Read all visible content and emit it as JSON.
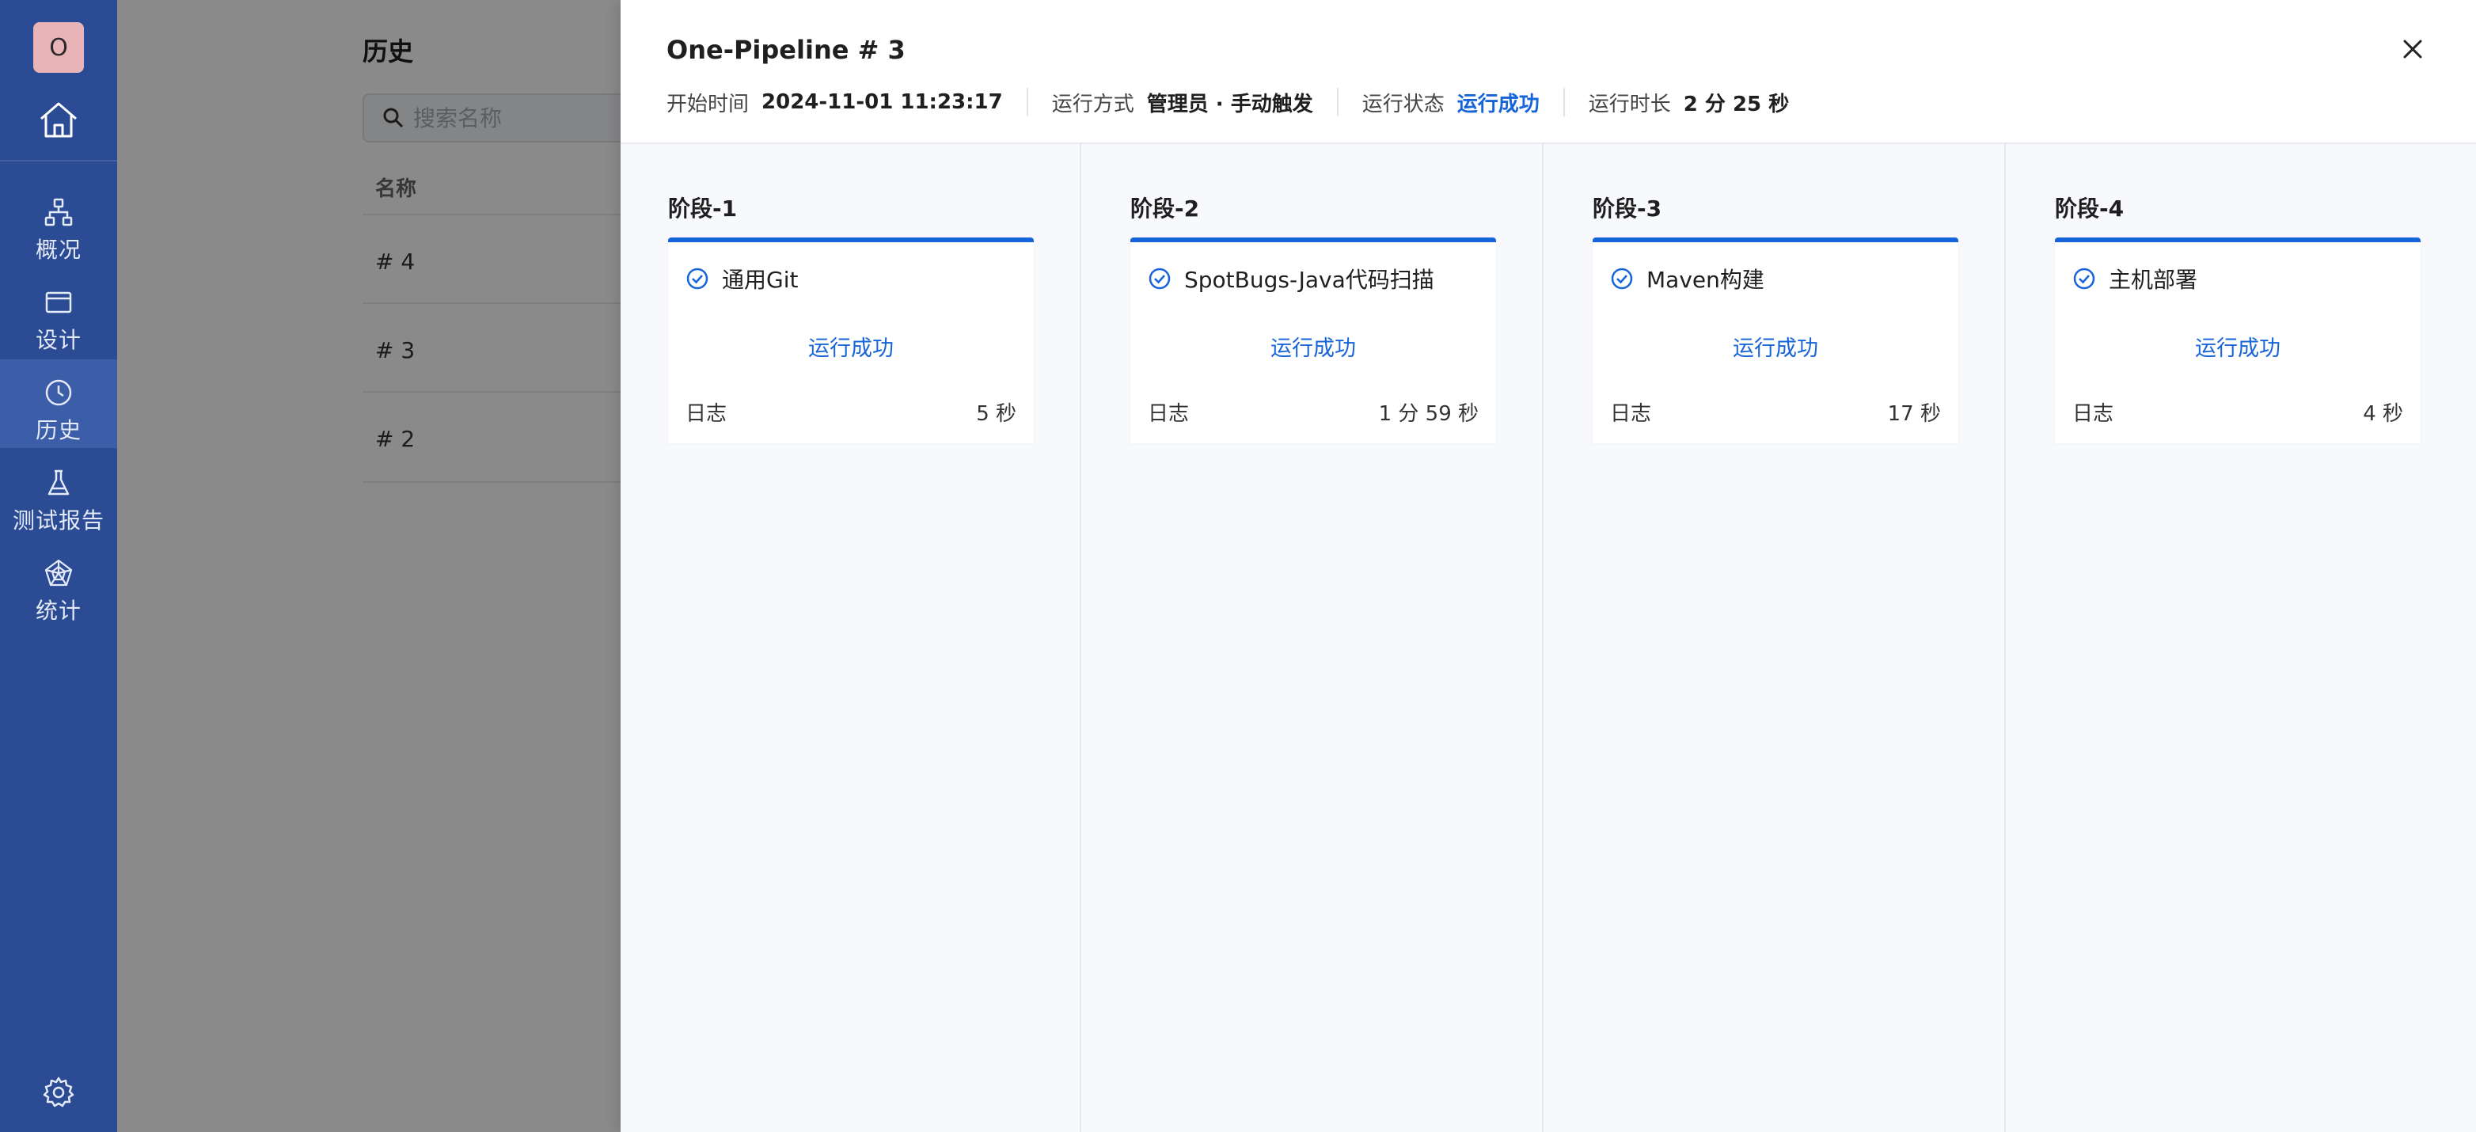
{
  "sidebar": {
    "avatar_initial": "O",
    "items": [
      {
        "label": "概况"
      },
      {
        "label": "设计"
      },
      {
        "label": "历史"
      },
      {
        "label": "测试报告"
      },
      {
        "label": "统计"
      }
    ]
  },
  "history_page": {
    "title": "历史",
    "search_placeholder": "搜索名称",
    "column_name": "名称",
    "rows": [
      "# 4",
      "# 3",
      "# 2"
    ]
  },
  "drawer": {
    "title": "One-Pipeline # 3",
    "meta": {
      "start_label": "开始时间",
      "start_value": "2024-11-01 11:23:17",
      "mode_label": "运行方式",
      "mode_value": "管理员 · 手动触发",
      "status_label": "运行状态",
      "status_value": "运行成功",
      "duration_label": "运行时长",
      "duration_value": "2 分 25 秒"
    },
    "stages": [
      {
        "title": "阶段-1",
        "task": "通用Git",
        "status": "运行成功",
        "log_label": "日志",
        "duration": "5 秒"
      },
      {
        "title": "阶段-2",
        "task": "SpotBugs-Java代码扫描",
        "status": "运行成功",
        "log_label": "日志",
        "duration": "1 分 59 秒"
      },
      {
        "title": "阶段-3",
        "task": "Maven构建",
        "status": "运行成功",
        "log_label": "日志",
        "duration": "17 秒"
      },
      {
        "title": "阶段-4",
        "task": "主机部署",
        "status": "运行成功",
        "log_label": "日志",
        "duration": "4 秒"
      }
    ]
  },
  "colors": {
    "sidebar": "#2b4c95",
    "accent": "#1664d9",
    "success_text": "#1664d9"
  }
}
